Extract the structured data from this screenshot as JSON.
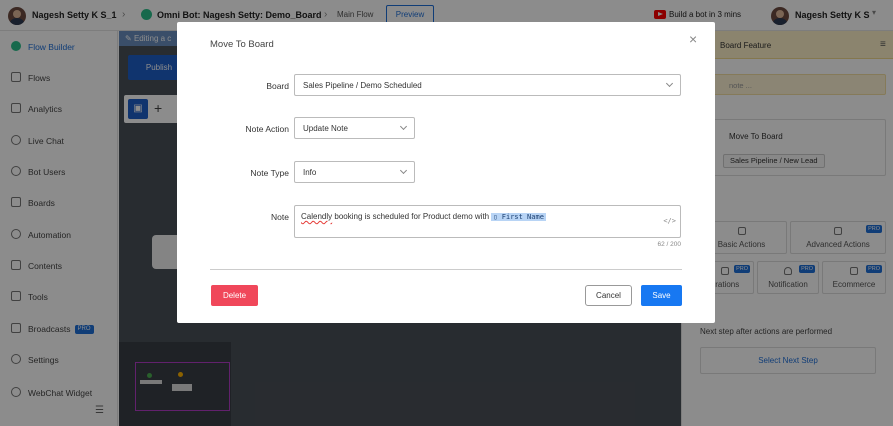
{
  "topbar": {
    "workspace": "Nagesh Setty K S_1",
    "bot_name": "Omni Bot: Nagesh Setty: Demo_Board",
    "flow_name": "Main Flow",
    "preview_label": "Preview",
    "help_link": "Build a bot in 3 mins",
    "user_name": "Nagesh Setty K S"
  },
  "sidebar": {
    "items": [
      {
        "label": "Flow Builder"
      },
      {
        "label": "Flows"
      },
      {
        "label": "Analytics"
      },
      {
        "label": "Live Chat"
      },
      {
        "label": "Bot Users"
      },
      {
        "label": "Boards"
      },
      {
        "label": "Automation"
      },
      {
        "label": "Contents"
      },
      {
        "label": "Tools"
      },
      {
        "label": "Broadcasts",
        "badge": "PRO"
      },
      {
        "label": "Settings"
      },
      {
        "label": "WebChat Widget"
      }
    ]
  },
  "canvas": {
    "editing_label": "Editing a c",
    "publish_label": "Publish"
  },
  "right_panel": {
    "title": "Board Feature",
    "note_placeholder": "note ...",
    "card_title": "Move To Board",
    "card_chip": "Sales Pipeline / New Lead",
    "tiles": [
      {
        "label": "Basic Actions",
        "pro": false
      },
      {
        "label": "Advanced Actions",
        "pro": true
      },
      {
        "label": "grations",
        "pro": true
      },
      {
        "label": "Notification",
        "pro": true
      },
      {
        "label": "Ecommerce",
        "pro": true
      }
    ],
    "pro_badge": "PRO",
    "next_step_text": "Next step after actions are performed",
    "select_next_label": "Select Next Step"
  },
  "modal": {
    "title": "Move To Board",
    "close_glyph": "×",
    "board_label": "Board",
    "board_value": "Sales Pipeline / Demo Scheduled",
    "note_action_label": "Note Action",
    "note_action_value": "Update Note",
    "note_type_label": "Note Type",
    "note_type_value": "Info",
    "note_label": "Note",
    "note_word_flagged": "Calendly",
    "note_text_rest": " booking is scheduled for Product demo with ",
    "note_variable": "▯ First Name",
    "code_icon": "</>",
    "char_count": "62 / 200",
    "delete_label": "Delete",
    "cancel_label": "Cancel",
    "save_label": "Save"
  },
  "colors": {
    "primary": "#1778f2",
    "danger": "#f0475a",
    "highlight_panel": "#fdf0c8"
  }
}
